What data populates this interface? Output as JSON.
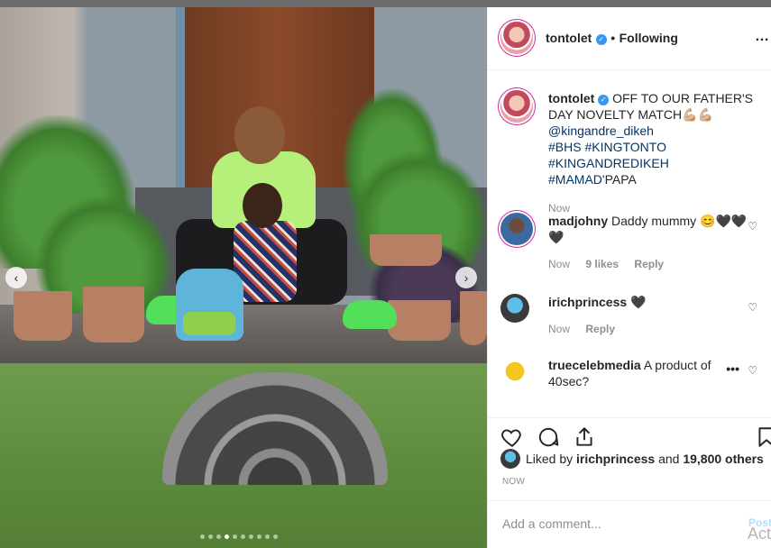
{
  "post": {
    "author": "tontolet",
    "follow_label": "Following",
    "separator": "•",
    "more_label": "…"
  },
  "caption": {
    "author": "tontolet",
    "text": "OFF TO OUR FATHER'S DAY NOVELTY MATCH💪🏼💪🏼",
    "mention": "@kingandre_dikeh",
    "hashtags_line1": "#BHS #KINGTONTO",
    "hashtags_line2_tag1": "#KINGANDREDIKEH",
    "hashtags_line2_tag2": "#MAMAD",
    "hashtags_line2_suffix": "'PAPA",
    "time": "Now"
  },
  "comments": [
    {
      "user": "madjohny",
      "text": "Daddy mummy 😊🖤🖤",
      "text2": "🖤",
      "time": "Now",
      "likes": "9 likes",
      "reply": "Reply"
    },
    {
      "user": "irichprincess",
      "text": "🖤",
      "time": "Now",
      "reply": "Reply"
    },
    {
      "user": "truecelebmedia",
      "text": "A product of 40sec?",
      "more": "•••"
    }
  ],
  "likes_line": {
    "prefix": "Liked by",
    "user": "irichprincess",
    "middle": "and",
    "count": "19,800 others"
  },
  "timestamp": "NOW",
  "add_comment": {
    "placeholder": "Add a comment...",
    "post_label": "Post"
  },
  "watermark": "Act",
  "carousel": {
    "count": 10,
    "active_index": 3
  },
  "icons": {
    "heart": "heart-icon",
    "comment": "comment-icon",
    "share": "share-icon",
    "save": "bookmark-icon",
    "verified": "verified-badge-icon"
  },
  "colors": {
    "link": "#003569",
    "verified": "#3897f0",
    "muted": "#8e8e8e",
    "post_disabled": "#b2dffc"
  }
}
